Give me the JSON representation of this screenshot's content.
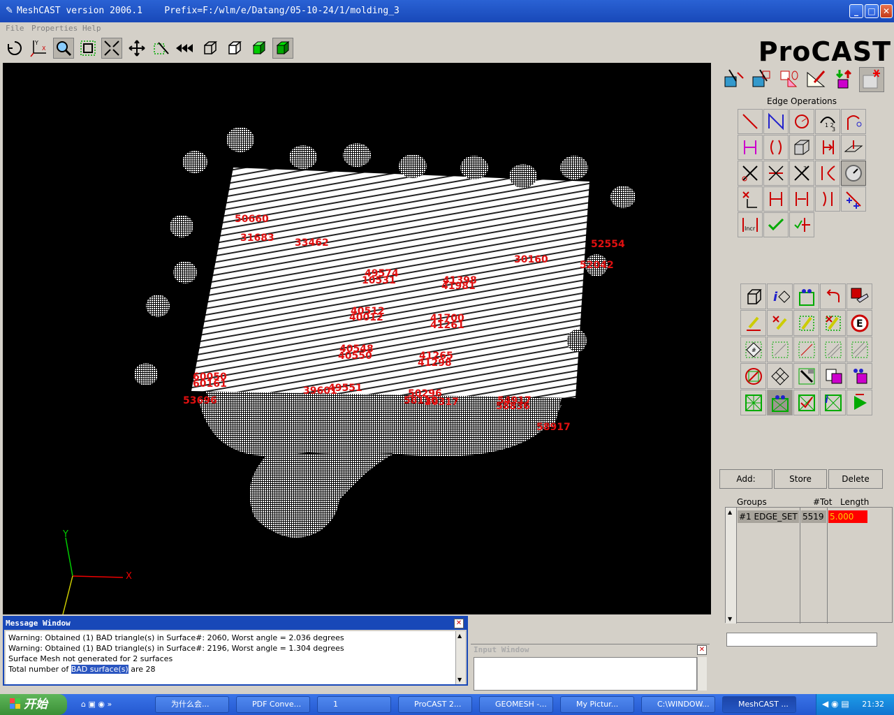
{
  "window": {
    "title": "MeshCAST version 2006.1    Prefix=F:/wlm/e/Datang/05-10-24/1/molding_3"
  },
  "menu": {
    "file": "File",
    "properties": "Properties",
    "help": "Help"
  },
  "logo": "ProCAST",
  "viewport": {
    "axes": {
      "x": "X",
      "y": "Y",
      "z": "Z"
    },
    "labels": [
      "50660",
      "31683",
      "33462",
      "52554",
      "30160",
      "52042",
      "49574",
      "10531",
      "41398",
      "41981",
      "40512",
      "40012",
      "41700",
      "41261",
      "40548",
      "40550",
      "41265",
      "41298",
      "60050",
      "60161",
      "39601",
      "49551",
      "50296",
      "54917",
      "58836",
      "53696",
      "58917",
      "30317",
      "58110"
    ]
  },
  "panel": {
    "edge_operations_title": "Edge Operations",
    "add_label": "Add:",
    "store_label": "Store",
    "delete_label": "Delete",
    "groups_header": "Groups",
    "tot_header": "#Tot",
    "length_header": "Length",
    "group_rows": [
      {
        "name": "#1  EDGE_SET",
        "tot": "5519",
        "length": "5.000"
      }
    ]
  },
  "message_window": {
    "title": "Message Window",
    "line1": "Warning: Obtained (1) BAD triangle(s) in Surface#: 2060, Worst angle = 2.036 degrees",
    "line2": "Warning: Obtained (1) BAD triangle(s) in Surface#: 2196, Worst angle = 1.304 degrees",
    "line3": "Surface Mesh not generated for 2 surfaces",
    "line4_pre": "Total number of ",
    "line4_hl": "BAD surface(s)",
    "line4_post": " are 28"
  },
  "input_window": {
    "title": "Input Window"
  },
  "taskbar": {
    "start": "开始",
    "tasks": [
      "为什么会...",
      "PDF Conve...",
      "1",
      "ProCAST 2...",
      "GEOMESH -...",
      "My Pictur...",
      "C:\\WINDOW...",
      "MeshCAST ..."
    ],
    "clock": "21:32"
  },
  "colors": {
    "accent": "#1848b8",
    "label_red": "#e01010",
    "length_red": "#ff0000"
  }
}
